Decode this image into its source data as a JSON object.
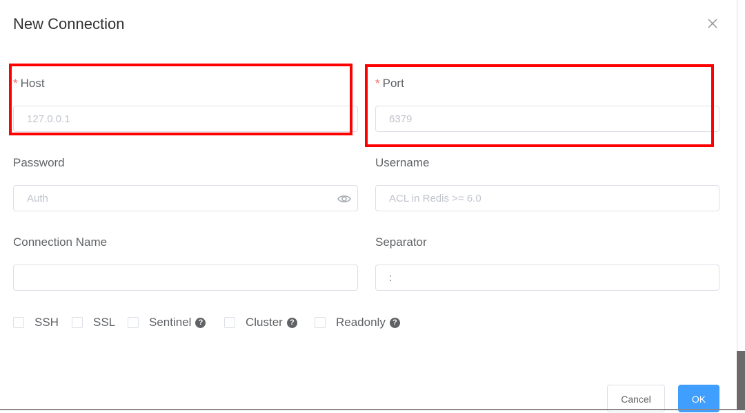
{
  "dialog": {
    "title": "New Connection",
    "close_icon": "close-icon"
  },
  "fields": {
    "host": {
      "label": "Host",
      "required_mark": "*",
      "placeholder": "127.0.0.1",
      "value": ""
    },
    "port": {
      "label": "Port",
      "required_mark": "*",
      "placeholder": "6379",
      "value": ""
    },
    "password": {
      "label": "Password",
      "placeholder": "Auth",
      "value": "",
      "toggle_icon": "eye-icon"
    },
    "username": {
      "label": "Username",
      "placeholder": "ACL in Redis >= 6.0",
      "value": ""
    },
    "connection_name": {
      "label": "Connection Name",
      "placeholder": "",
      "value": ""
    },
    "separator": {
      "label": "Separator",
      "placeholder": "",
      "value": ":"
    }
  },
  "options": [
    {
      "label": "SSH",
      "checked": false,
      "help": false
    },
    {
      "label": "SSL",
      "checked": false,
      "help": false
    },
    {
      "label": "Sentinel",
      "checked": false,
      "help": true,
      "help_glyph": "?"
    },
    {
      "label": "Cluster",
      "checked": false,
      "help": true,
      "help_glyph": "?"
    },
    {
      "label": "Readonly",
      "checked": false,
      "help": true,
      "help_glyph": "?"
    }
  ],
  "footer": {
    "cancel_label": "Cancel",
    "ok_label": "OK"
  },
  "annotations": {
    "highlight_color": "#ff0000"
  }
}
